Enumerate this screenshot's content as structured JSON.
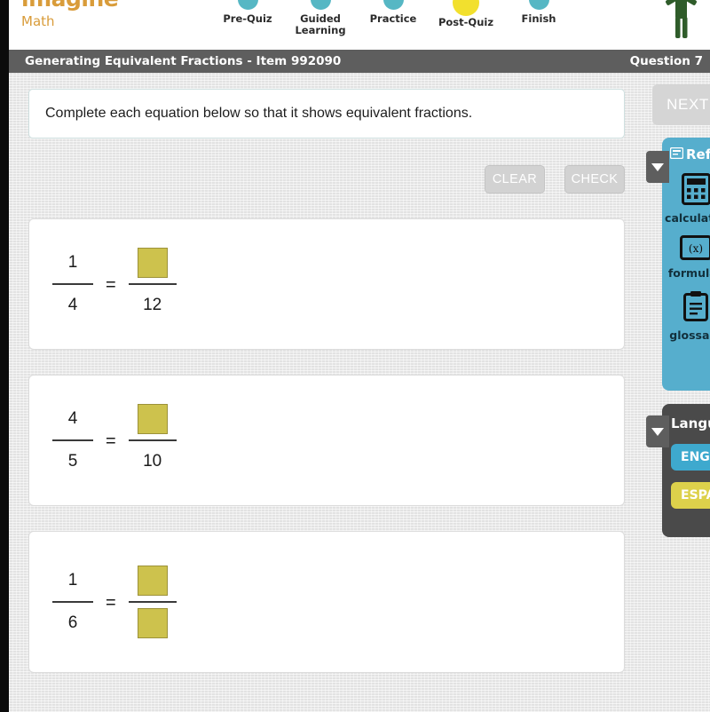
{
  "brand": {
    "name_line1": "imagine",
    "name_line2": "Math"
  },
  "stepper": {
    "steps": [
      {
        "label": "Pre-Quiz",
        "state": "done"
      },
      {
        "label": "Guided\nLearning",
        "state": "done"
      },
      {
        "label": "Practice",
        "state": "done"
      },
      {
        "label": "Post-Quiz",
        "state": "current"
      },
      {
        "label": "Finish",
        "state": "upcoming"
      }
    ],
    "dot_color_done": "#56b7c4",
    "dot_color_current": "#f2e02e"
  },
  "titlebar": {
    "lesson_title": "Generating Equivalent Fractions - Item 992090",
    "question_counter": "Question 7",
    "background": "#5e5e5e"
  },
  "prompt": {
    "text": "Complete each equation below so that it shows equivalent fractions."
  },
  "toolbar": {
    "clear_label": "CLEAR",
    "check_label": "CHECK"
  },
  "next_button": {
    "label": "NEXT",
    "enabled": false
  },
  "reference_panel": {
    "title": "Reference",
    "icon": "reference-icon",
    "background": "#56aecd",
    "items": [
      {
        "label": "calculator",
        "icon": "calculator-icon"
      },
      {
        "label": "formulas",
        "icon": "formulas-icon"
      },
      {
        "label": "glossary",
        "icon": "glossary-icon"
      }
    ]
  },
  "language_panel": {
    "title": "Language",
    "background": "#4a4a4a",
    "options": [
      {
        "label": "ENGLISH",
        "color": "#3ea9ce",
        "selected": true
      },
      {
        "label": "ESPAÑOL",
        "color": "#ddd14b",
        "selected": false
      }
    ]
  },
  "equations": [
    {
      "left": {
        "numerator": "1",
        "denominator": "4"
      },
      "equals": "=",
      "right": {
        "numerator": "",
        "numerator_input": true,
        "denominator": "12",
        "denominator_input": false
      }
    },
    {
      "left": {
        "numerator": "4",
        "denominator": "5"
      },
      "equals": "=",
      "right": {
        "numerator": "",
        "numerator_input": true,
        "denominator": "10",
        "denominator_input": false
      }
    },
    {
      "left": {
        "numerator": "1",
        "denominator": "6"
      },
      "equals": "=",
      "right": {
        "numerator": "",
        "numerator_input": true,
        "denominator": "",
        "denominator_input": true
      }
    }
  ],
  "answer_box_color": "#cdc24d",
  "page_background": "#e8e8e8"
}
